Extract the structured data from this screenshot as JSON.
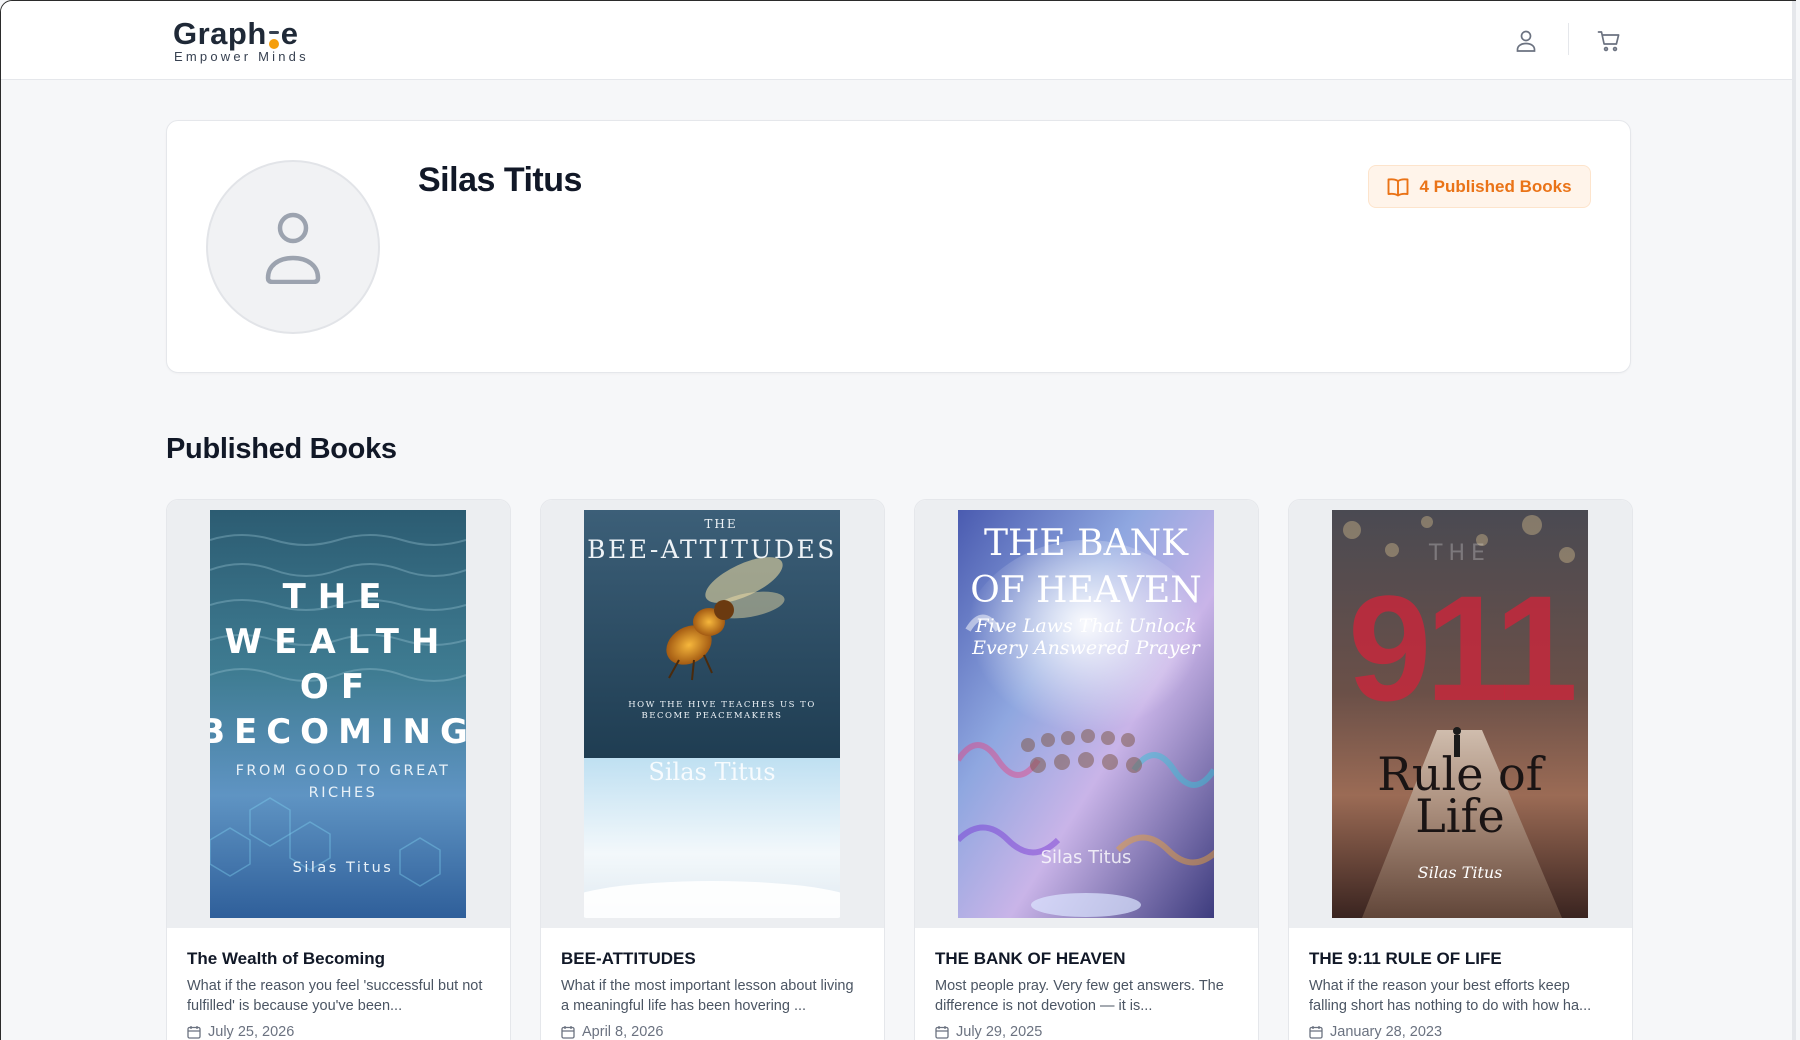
{
  "header": {
    "logo_main": "Graph",
    "logo_tail": "e",
    "logo_tagline": "Empower Minds",
    "user_icon": "user-icon",
    "cart_icon": "cart-icon"
  },
  "profile": {
    "name": "Silas Titus",
    "avatar_icon": "user-placeholder-icon",
    "badge_icon": "open-book-icon",
    "badge_label": "4 Published Books",
    "accent_color": "#ea7317"
  },
  "section": {
    "title": "Published Books"
  },
  "books": [
    {
      "title": "The Wealth of Becoming",
      "description": "What if the reason you feel 'successful but not fulfilled' is because you've been...",
      "date": "July 25, 2026",
      "cover": {
        "line1": "THE",
        "line2": "WEALTH",
        "line3": "OF",
        "line4": "BECOMING",
        "subtitle1": "FROM GOOD TO GREAT",
        "subtitle2": "RICHES",
        "author": "Silas Titus"
      }
    },
    {
      "title": "BEE-ATTITUDES",
      "description": "What if the most important lesson about living a meaningful life has been hovering ...",
      "date": "April 8, 2026",
      "cover": {
        "kicker": "THE",
        "title": "BEE-ATTITUDES",
        "subtitle1": "HOW THE HIVE TEACHES US TO",
        "subtitle2": "BECOME PEACEMAKERS",
        "author": "Silas Titus"
      }
    },
    {
      "title": "THE BANK OF HEAVEN",
      "description": "Most people pray. Very few get answers. The difference is not devotion — it is...",
      "date": "July 29, 2025",
      "cover": {
        "line1": "THE BANK",
        "line2": "OF HEAVEN",
        "subtitle1": "Five Laws That Unlock",
        "subtitle2": "Every Answered Prayer",
        "author": "Silas Titus"
      }
    },
    {
      "title": "THE 9:11 RULE OF LIFE",
      "description": "What if the reason your best efforts keep falling short has nothing to do with how ha...",
      "date": "January 28, 2023",
      "cover": {
        "kicker": "THE",
        "number": "911",
        "line1": "Rule of",
        "line2": "Life",
        "author": "Silas Titus"
      }
    }
  ]
}
